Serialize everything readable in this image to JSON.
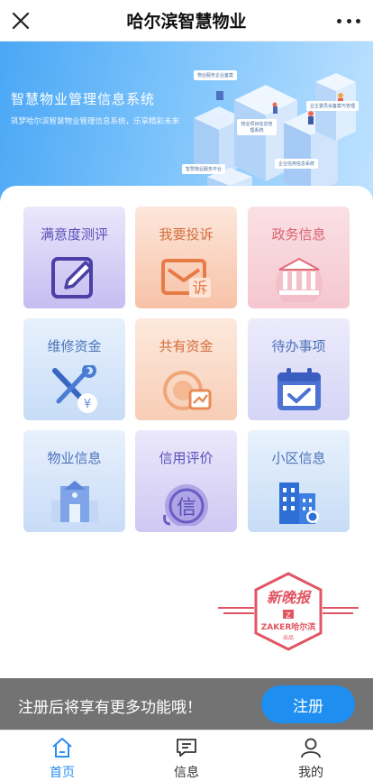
{
  "header": {
    "title": "哈尔滨智慧物业"
  },
  "banner": {
    "title": "智慧物业管理信息系统",
    "subtitle": "筑梦哈尔滨智慧物业管理信息系统，乐享精彩未来",
    "tags": [
      "物业服务企业备案",
      "业主委员会备案与管理",
      "物业项目信息管理系统",
      "企业信用信息系统",
      "智慧物业服务平台"
    ]
  },
  "grid": {
    "tiles": [
      {
        "label": "满意度测评",
        "icon": "pencil-icon"
      },
      {
        "label": "我要投诉",
        "icon": "complaint-mail-icon"
      },
      {
        "label": "政务信息",
        "icon": "government-building-icon"
      },
      {
        "label": "维修资金",
        "icon": "repair-tools-icon"
      },
      {
        "label": "共有资金",
        "icon": "shared-funds-icon"
      },
      {
        "label": "待办事项",
        "icon": "calendar-check-icon"
      },
      {
        "label": "物业信息",
        "icon": "property-building-icon"
      },
      {
        "label": "信用评价",
        "icon": "credit-icon"
      },
      {
        "label": "小区信息",
        "icon": "residential-buildings-icon"
      }
    ],
    "credit_icon_char": "信",
    "complaint_icon_char": "诉",
    "yen_char": "¥"
  },
  "stamp": {
    "title": "新晚报",
    "brand": "ZAKER哈尔滨",
    "sub": "出品",
    "badge": "Z"
  },
  "register": {
    "text": "注册后将享有更多功能哦！",
    "button": "注册"
  },
  "nav": {
    "items": [
      {
        "label": "首页",
        "icon": "home-icon",
        "active": true
      },
      {
        "label": "信息",
        "icon": "message-icon",
        "active": false
      },
      {
        "label": "我的",
        "icon": "user-icon",
        "active": false
      }
    ]
  },
  "colors": {
    "accent": "#2a8ef0",
    "register_button": "#1e8ff0",
    "stamp_red": "#e05561"
  }
}
